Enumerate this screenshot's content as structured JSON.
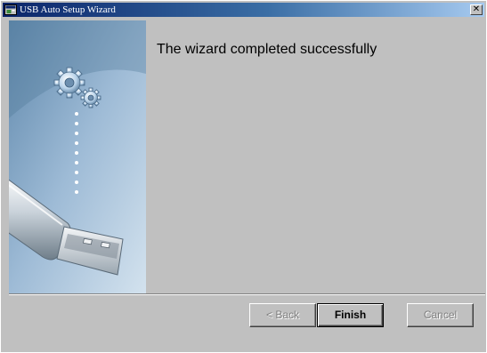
{
  "window": {
    "title": "USB Auto Setup Wizard",
    "close_glyph": "✕",
    "title_icon": "wizard-app-icon"
  },
  "side_panel": {
    "illustration": "usb-drive-with-gears"
  },
  "main": {
    "heading": "The wizard completed successfully"
  },
  "buttons": {
    "back": "< Back",
    "finish": "Finish",
    "cancel": "Cancel"
  },
  "colors": {
    "dialog_bg": "#c0c0c0",
    "titlebar_start": "#0a246a",
    "titlebar_end": "#a6caf0"
  }
}
